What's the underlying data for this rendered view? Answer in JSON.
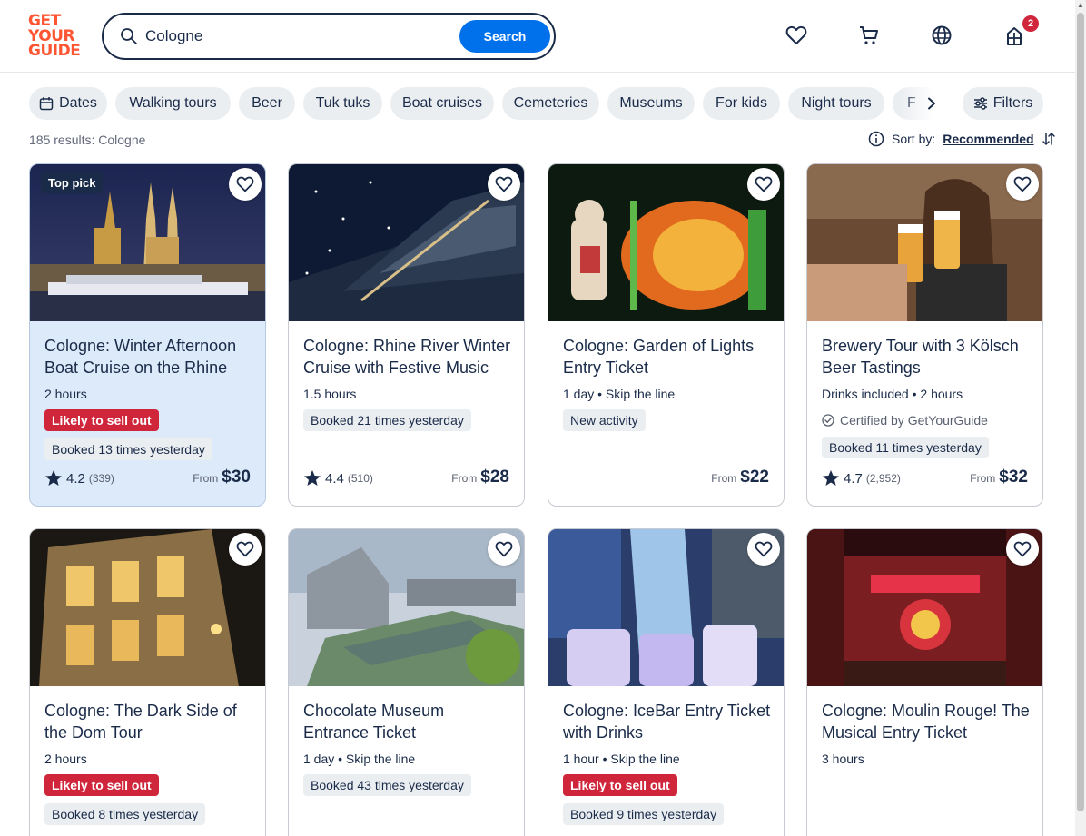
{
  "header": {
    "logo_lines": [
      "GET",
      "YOUR",
      "GUIDE"
    ],
    "search": {
      "value": "Cologne",
      "placeholder": "",
      "button_label": "Search"
    },
    "cart_count": "2"
  },
  "chips": [
    "Dates",
    "Walking tours",
    "Beer",
    "Tuk tuks",
    "Boat cruises",
    "Cemeteries",
    "Museums",
    "For kids",
    "Night tours",
    "F"
  ],
  "filters_label": "Filters",
  "results_text": "185 results: Cologne",
  "sort": {
    "label": "Sort by:",
    "value": "Recommended"
  },
  "colors": {
    "accent": "#0071eb",
    "brand": "#ff5533",
    "danger": "#d0263b",
    "text": "#1a2b49"
  },
  "cards": [
    {
      "badge": "Top pick",
      "title": "Cologne: Winter Afternoon Boat Cruise on the Rhine",
      "meta": "2 hours",
      "tag_red": "Likely to sell out",
      "tag_grey": "Booked 13 times yesterday",
      "rating": "4.2",
      "reviews": "(339)",
      "price_from": "From",
      "price": "$30"
    },
    {
      "title": "Cologne: Rhine River Winter Cruise with Festive Music",
      "meta": "1.5 hours",
      "tag_grey": "Booked 21 times yesterday",
      "rating": "4.4",
      "reviews": "(510)",
      "price_from": "From",
      "price": "$28"
    },
    {
      "title": "Cologne: Garden of Lights Entry Ticket",
      "meta": "1 day • Skip the line",
      "tag_grey": "New activity",
      "price_from": "From",
      "price": "$22"
    },
    {
      "title": "Brewery Tour with 3 Kölsch Beer Tastings",
      "meta": "Drinks included • 2 hours",
      "certified": "Certified by GetYourGuide",
      "tag_grey": "Booked 11 times yesterday",
      "rating": "4.7",
      "reviews": "(2,952)",
      "price_from": "From",
      "price": "$32"
    },
    {
      "title": "Cologne: The Dark Side of the Dom Tour",
      "meta": "2 hours",
      "tag_red": "Likely to sell out",
      "tag_grey": "Booked 8 times yesterday"
    },
    {
      "title": "Chocolate Museum Entrance Ticket",
      "meta": "1 day • Skip the line",
      "tag_grey": "Booked 43 times yesterday"
    },
    {
      "title": "Cologne: IceBar Entry Ticket with Drinks",
      "meta": "1 hour • Skip the line",
      "tag_red": "Likely to sell out",
      "tag_grey": "Booked 9 times yesterday"
    },
    {
      "title": "Cologne: Moulin Rouge! The Musical Entry Ticket",
      "meta": "3 hours"
    }
  ]
}
